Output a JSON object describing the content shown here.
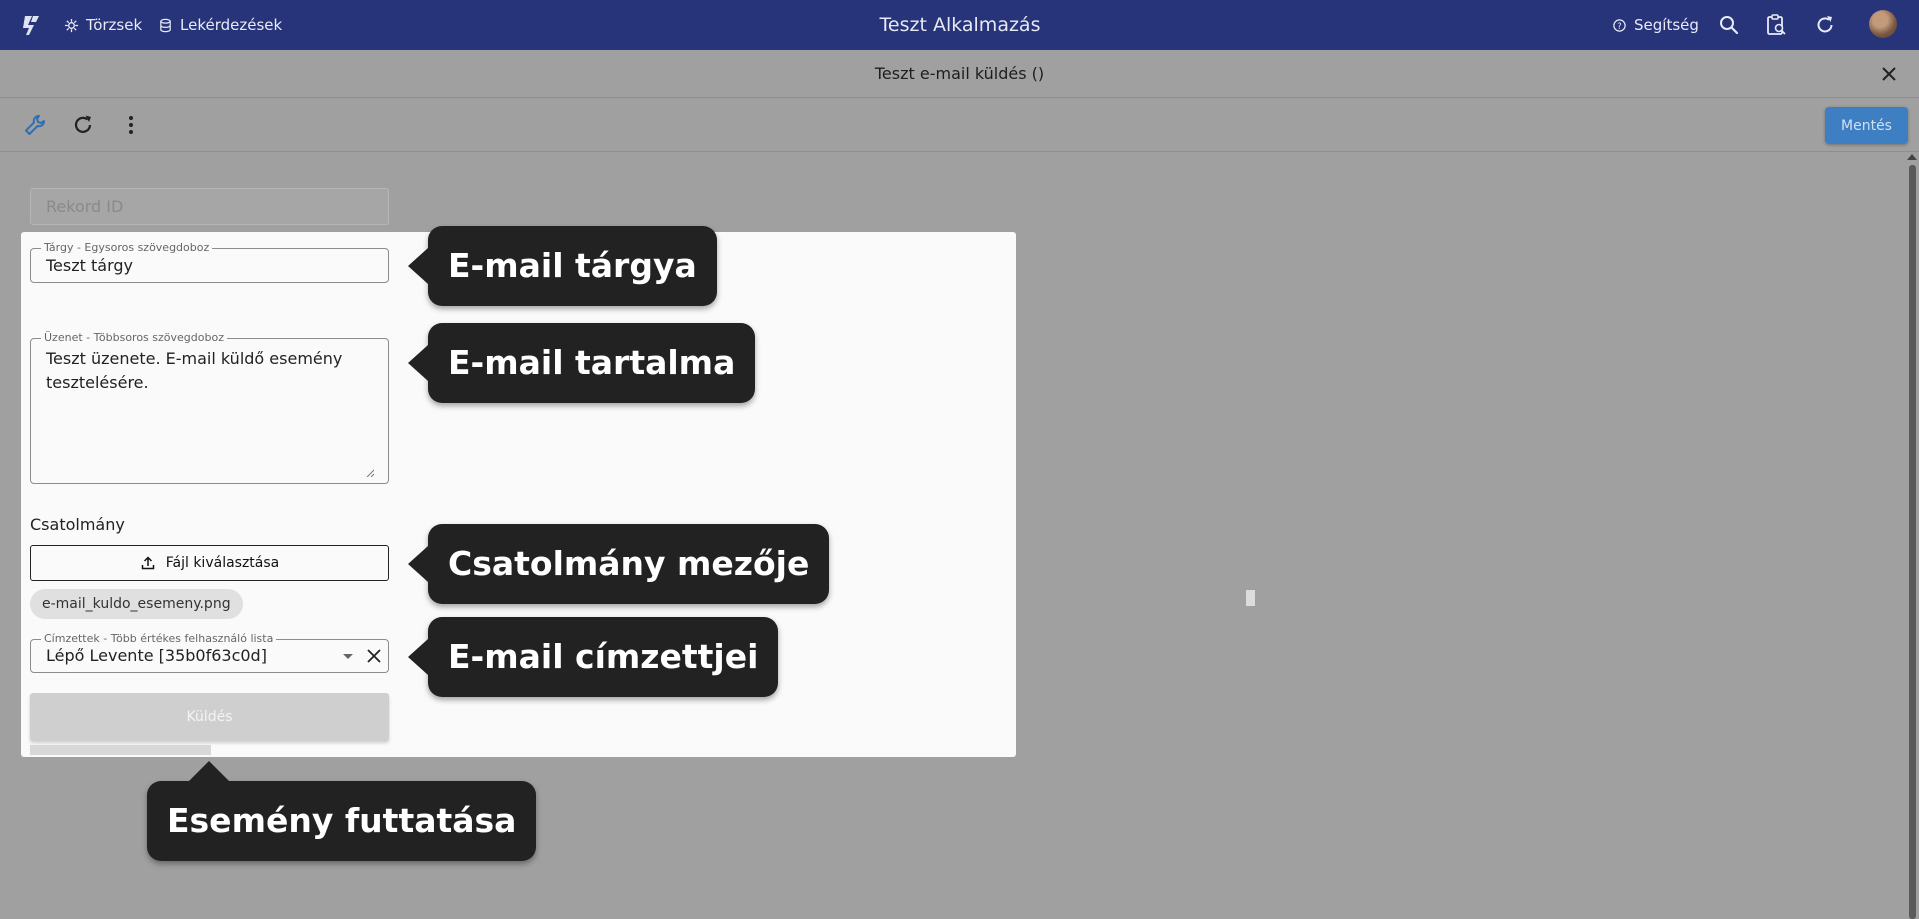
{
  "appbar": {
    "title": "Teszt Alkalmazás",
    "nav": [
      {
        "label": "Törzsek",
        "icon": "gear-icon"
      },
      {
        "label": "Lekérdezések",
        "icon": "database-icon"
      }
    ],
    "help_label": "Segítség"
  },
  "dialog": {
    "title": "Teszt e-mail küldés ()"
  },
  "toolbar": {
    "save_label": "Mentés"
  },
  "form": {
    "record_id_placeholder": "Rekord ID",
    "subject": {
      "label": "Tárgy - Egysoros szövegdoboz",
      "value": "Teszt tárgy"
    },
    "message": {
      "label": "Üzenet - Többsoros szövegdoboz",
      "value": "Teszt üzenete. E-mail küldő esemény tesztelésére."
    },
    "attachment": {
      "label": "Csatolmány",
      "button_label": "Fájl kiválasztása",
      "file_name": "e-mail_kuldo_esemeny.png"
    },
    "recipients": {
      "label": "Címzettek - Több értékes felhasználó lista",
      "value": "Lépő Levente [35b0f63c0d]"
    },
    "send_label": "Küldés"
  },
  "callouts": {
    "subject": "E-mail tárgya",
    "message": "E-mail tartalma",
    "attachment": "Csatolmány mezője",
    "recipients": "E-mail címzettjei",
    "run_event": "Esemény futtatása"
  },
  "colors": {
    "appbar": "#27347a",
    "save_button": "#3e7fc4",
    "overlay": "#a0a0a0",
    "callout": "#222222"
  }
}
